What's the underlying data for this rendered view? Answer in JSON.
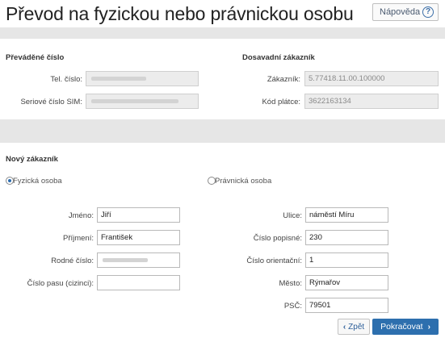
{
  "header": {
    "title": "Převod na fyzickou nebo právnickou osobu",
    "help_label": "Nápověda",
    "help_icon": "question-circle-icon"
  },
  "current_number": {
    "heading": "Převáděné číslo",
    "phone_label": "Tel. číslo:",
    "sim_label": "Seriové číslo SIM:"
  },
  "previous_customer": {
    "heading": "Dosavadní zákazník",
    "customer_label": "Zákazník:",
    "customer_value": "5.77418.11.00.100000",
    "payer_label": "Kód plátce:",
    "payer_value": "3622163134"
  },
  "new_customer": {
    "heading": "Nový zákazník",
    "type_person_label": "Fyzická osoba",
    "type_company_label": "Právnická osoba",
    "selected_type": "person",
    "first_name_label": "Jméno:",
    "first_name_value": "Jiří",
    "last_name_label": "Příjmení:",
    "last_name_value": "František",
    "birth_number_label": "Rodné číslo:",
    "passport_label": "Číslo pasu (cizinci):",
    "passport_value": "",
    "street_label": "Ulice:",
    "street_value": "náměstí Míru",
    "house_no_label": "Číslo popisné:",
    "house_no_value": "230",
    "orient_no_label": "Číslo orientační:",
    "orient_no_value": "1",
    "city_label": "Město:",
    "city_value": "Rýmařov",
    "zip_label": "PSČ:",
    "zip_value": "79501"
  },
  "footer": {
    "back_label": "Zpět",
    "next_label": "Pokračovat"
  },
  "colors": {
    "primary": "#2d6fae",
    "band": "#e6e6e6"
  }
}
